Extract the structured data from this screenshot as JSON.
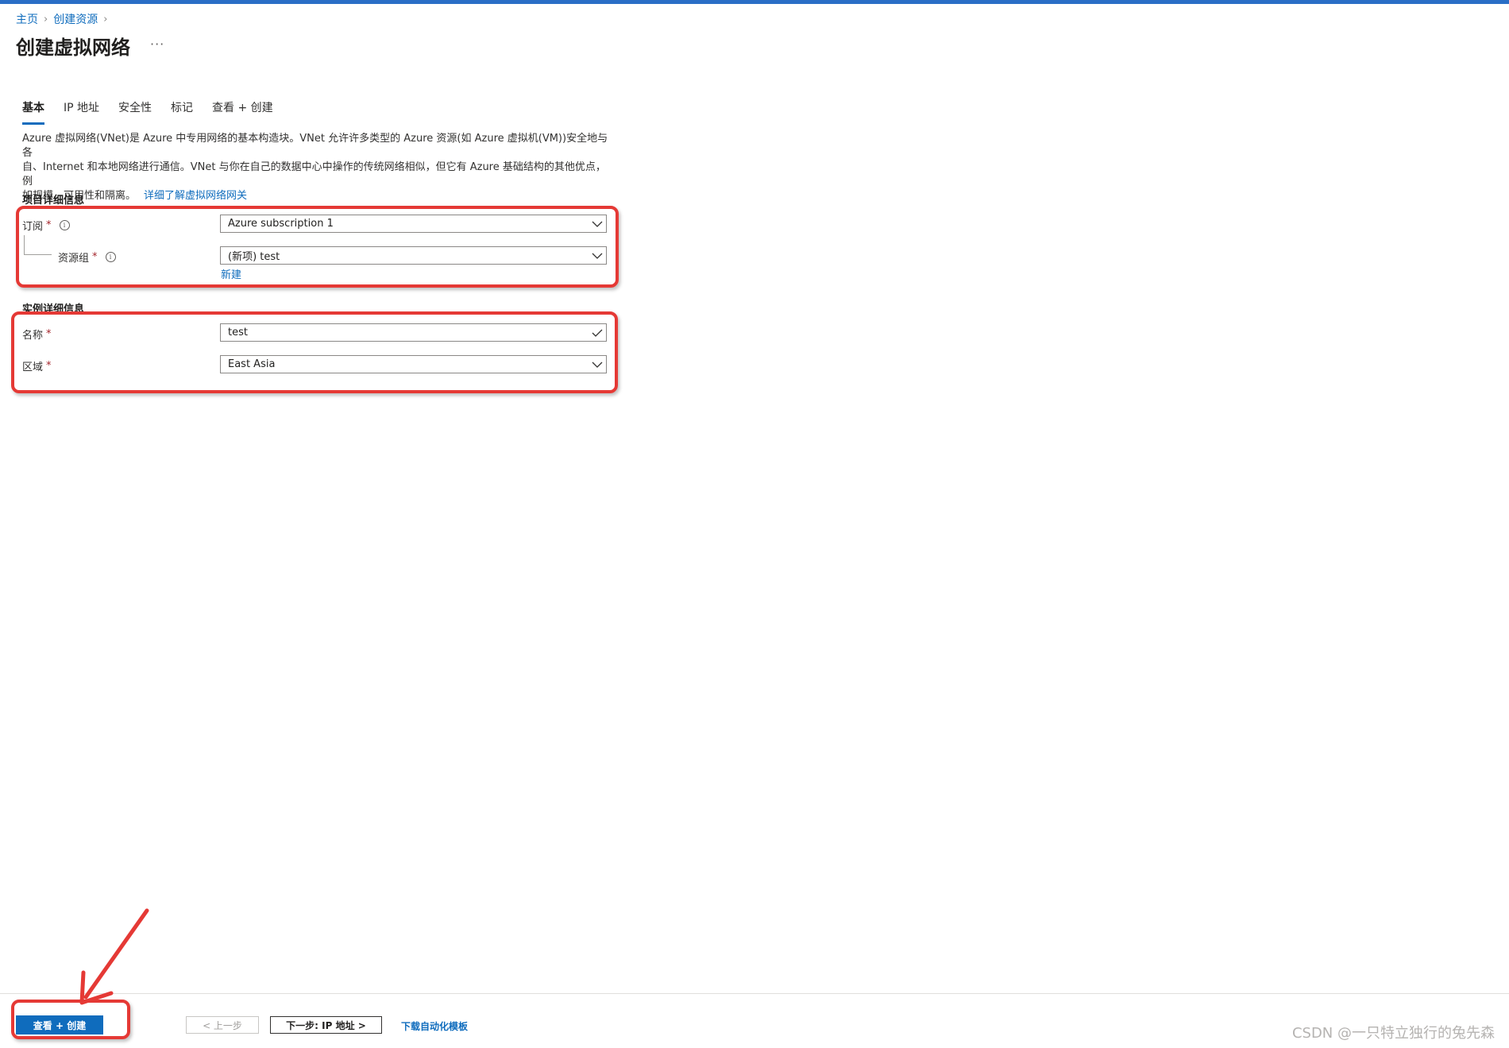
{
  "breadcrumb": {
    "home": "主页",
    "create_resource": "创建资源"
  },
  "page": {
    "title": "创建虚拟网络",
    "more": "···"
  },
  "tabs": [
    {
      "label": "基本",
      "active": true
    },
    {
      "label": "IP 地址",
      "active": false
    },
    {
      "label": "安全性",
      "active": false
    },
    {
      "label": "标记",
      "active": false
    },
    {
      "label": "查看 + 创建",
      "active": false
    }
  ],
  "intro": {
    "line1": "Azure 虚拟网络(VNet)是 Azure 中专用网络的基本构造块。VNet 允许许多类型的 Azure 资源(如 Azure 虚拟机(VM))安全地与各",
    "line2": "自、Internet 和本地网络进行通信。VNet 与你在自己的数据中心中操作的传统网络相似，但它有 Azure 基础结构的其他优点，例",
    "line3": "如规模、可用性和隔离。",
    "learn_more": "详细了解虚拟网络网关"
  },
  "project_details": {
    "title": "项目详细信息",
    "subscription": {
      "label": "订阅",
      "required": "*",
      "value": "Azure subscription 1"
    },
    "resource_group": {
      "label": "资源组",
      "required": "*",
      "value": "(新项) test",
      "create_new": "新建"
    }
  },
  "instance_details": {
    "title": "实例详细信息",
    "name": {
      "label": "名称",
      "required": "*",
      "value": "test"
    },
    "region": {
      "label": "区域",
      "required": "*",
      "value": "East Asia"
    }
  },
  "footer": {
    "review_create": "查看 + 创建",
    "previous": "< 上一步",
    "next": "下一步: IP 地址 >",
    "download_template": "下载自动化模板"
  },
  "watermark": "CSDN @一只特立独行的兔先森",
  "colors": {
    "accent": "#0f6cbd",
    "annotation_red": "#e53935",
    "required": "#a4262c"
  }
}
